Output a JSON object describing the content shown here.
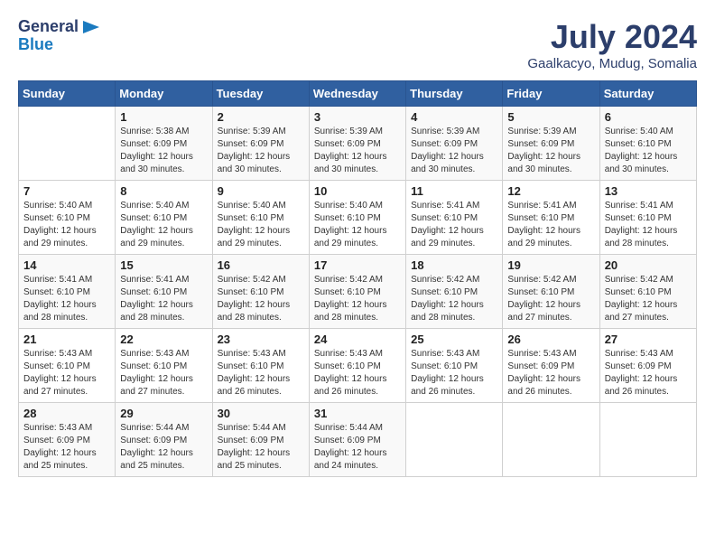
{
  "logo": {
    "line1": "General",
    "line2": "Blue"
  },
  "title": "July 2024",
  "location": "Gaalkacyo, Mudug, Somalia",
  "days_header": [
    "Sunday",
    "Monday",
    "Tuesday",
    "Wednesday",
    "Thursday",
    "Friday",
    "Saturday"
  ],
  "weeks": [
    [
      {
        "num": "",
        "info": ""
      },
      {
        "num": "1",
        "info": "Sunrise: 5:38 AM\nSunset: 6:09 PM\nDaylight: 12 hours\nand 30 minutes."
      },
      {
        "num": "2",
        "info": "Sunrise: 5:39 AM\nSunset: 6:09 PM\nDaylight: 12 hours\nand 30 minutes."
      },
      {
        "num": "3",
        "info": "Sunrise: 5:39 AM\nSunset: 6:09 PM\nDaylight: 12 hours\nand 30 minutes."
      },
      {
        "num": "4",
        "info": "Sunrise: 5:39 AM\nSunset: 6:09 PM\nDaylight: 12 hours\nand 30 minutes."
      },
      {
        "num": "5",
        "info": "Sunrise: 5:39 AM\nSunset: 6:09 PM\nDaylight: 12 hours\nand 30 minutes."
      },
      {
        "num": "6",
        "info": "Sunrise: 5:40 AM\nSunset: 6:10 PM\nDaylight: 12 hours\nand 30 minutes."
      }
    ],
    [
      {
        "num": "7",
        "info": "Sunrise: 5:40 AM\nSunset: 6:10 PM\nDaylight: 12 hours\nand 29 minutes."
      },
      {
        "num": "8",
        "info": "Sunrise: 5:40 AM\nSunset: 6:10 PM\nDaylight: 12 hours\nand 29 minutes."
      },
      {
        "num": "9",
        "info": "Sunrise: 5:40 AM\nSunset: 6:10 PM\nDaylight: 12 hours\nand 29 minutes."
      },
      {
        "num": "10",
        "info": "Sunrise: 5:40 AM\nSunset: 6:10 PM\nDaylight: 12 hours\nand 29 minutes."
      },
      {
        "num": "11",
        "info": "Sunrise: 5:41 AM\nSunset: 6:10 PM\nDaylight: 12 hours\nand 29 minutes."
      },
      {
        "num": "12",
        "info": "Sunrise: 5:41 AM\nSunset: 6:10 PM\nDaylight: 12 hours\nand 29 minutes."
      },
      {
        "num": "13",
        "info": "Sunrise: 5:41 AM\nSunset: 6:10 PM\nDaylight: 12 hours\nand 28 minutes."
      }
    ],
    [
      {
        "num": "14",
        "info": "Sunrise: 5:41 AM\nSunset: 6:10 PM\nDaylight: 12 hours\nand 28 minutes."
      },
      {
        "num": "15",
        "info": "Sunrise: 5:41 AM\nSunset: 6:10 PM\nDaylight: 12 hours\nand 28 minutes."
      },
      {
        "num": "16",
        "info": "Sunrise: 5:42 AM\nSunset: 6:10 PM\nDaylight: 12 hours\nand 28 minutes."
      },
      {
        "num": "17",
        "info": "Sunrise: 5:42 AM\nSunset: 6:10 PM\nDaylight: 12 hours\nand 28 minutes."
      },
      {
        "num": "18",
        "info": "Sunrise: 5:42 AM\nSunset: 6:10 PM\nDaylight: 12 hours\nand 28 minutes."
      },
      {
        "num": "19",
        "info": "Sunrise: 5:42 AM\nSunset: 6:10 PM\nDaylight: 12 hours\nand 27 minutes."
      },
      {
        "num": "20",
        "info": "Sunrise: 5:42 AM\nSunset: 6:10 PM\nDaylight: 12 hours\nand 27 minutes."
      }
    ],
    [
      {
        "num": "21",
        "info": "Sunrise: 5:43 AM\nSunset: 6:10 PM\nDaylight: 12 hours\nand 27 minutes."
      },
      {
        "num": "22",
        "info": "Sunrise: 5:43 AM\nSunset: 6:10 PM\nDaylight: 12 hours\nand 27 minutes."
      },
      {
        "num": "23",
        "info": "Sunrise: 5:43 AM\nSunset: 6:10 PM\nDaylight: 12 hours\nand 26 minutes."
      },
      {
        "num": "24",
        "info": "Sunrise: 5:43 AM\nSunset: 6:10 PM\nDaylight: 12 hours\nand 26 minutes."
      },
      {
        "num": "25",
        "info": "Sunrise: 5:43 AM\nSunset: 6:10 PM\nDaylight: 12 hours\nand 26 minutes."
      },
      {
        "num": "26",
        "info": "Sunrise: 5:43 AM\nSunset: 6:09 PM\nDaylight: 12 hours\nand 26 minutes."
      },
      {
        "num": "27",
        "info": "Sunrise: 5:43 AM\nSunset: 6:09 PM\nDaylight: 12 hours\nand 26 minutes."
      }
    ],
    [
      {
        "num": "28",
        "info": "Sunrise: 5:43 AM\nSunset: 6:09 PM\nDaylight: 12 hours\nand 25 minutes."
      },
      {
        "num": "29",
        "info": "Sunrise: 5:44 AM\nSunset: 6:09 PM\nDaylight: 12 hours\nand 25 minutes."
      },
      {
        "num": "30",
        "info": "Sunrise: 5:44 AM\nSunset: 6:09 PM\nDaylight: 12 hours\nand 25 minutes."
      },
      {
        "num": "31",
        "info": "Sunrise: 5:44 AM\nSunset: 6:09 PM\nDaylight: 12 hours\nand 24 minutes."
      },
      {
        "num": "",
        "info": ""
      },
      {
        "num": "",
        "info": ""
      },
      {
        "num": "",
        "info": ""
      }
    ]
  ]
}
